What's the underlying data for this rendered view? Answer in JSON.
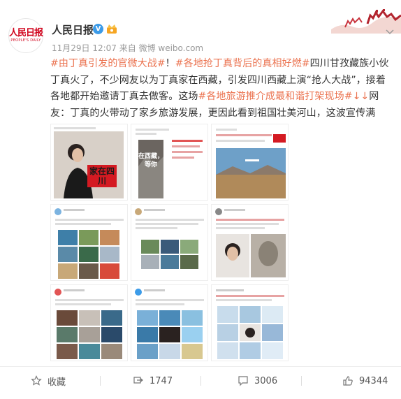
{
  "post": {
    "account_name": "人民日报",
    "logo_text": "人民日报",
    "logo_subtext": "PEOPLE'S DAILY",
    "meta": "11月29日 12:07 来自 微博 weibo.com",
    "text": {
      "hashtag1": "#由丁真引发的官微大战#",
      "sep1": "！",
      "hashtag2": "#各地抢丁真背后的真相好燃#",
      "body1": "四川甘孜藏族小伙丁真火了，不少网友以为丁真家在西藏，引发四川西藏上演“抢人大战”，接着各地都开始邀请丁真去做客。这场",
      "hashtag3": "#各地旅游推介成最和谐打架现场#",
      "arrows": "↓↓",
      "body2": "网友：丁真的火带动了家乡旅游发展，更因此看到祖国壮美河山，这波宣传满分！"
    },
    "images": {
      "img1_sign": "家在四川",
      "img2_title": "在西藏，等你"
    }
  },
  "actions": {
    "favorite_label": "收藏",
    "repost_count": "1747",
    "comment_count": "3006",
    "like_count": "94344"
  },
  "colors": {
    "accent": "#eb7350",
    "brand_red": "#d0021b",
    "verified_blue": "#3c9be8"
  }
}
